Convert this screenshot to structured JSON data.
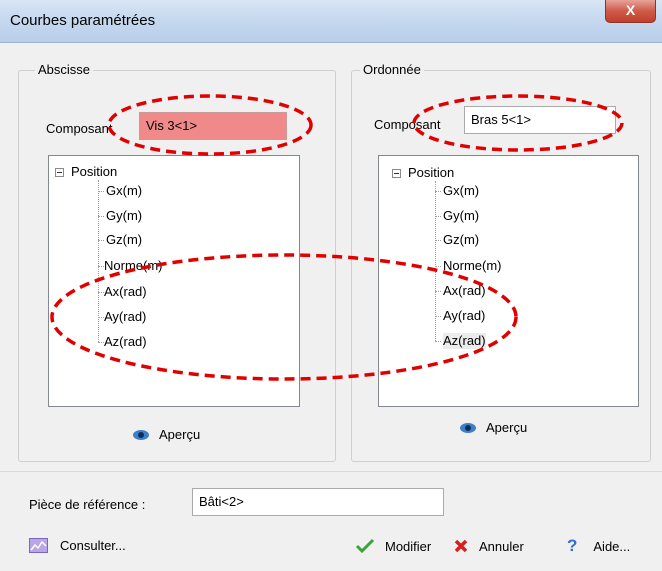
{
  "window": {
    "title": "Courbes paramétrées",
    "close_glyph": "X"
  },
  "abscisse": {
    "title": "Abscisse",
    "composant_label": "Composant",
    "composant_value": "Vis 3<1>",
    "tree_root": "Position",
    "tree_items": [
      "Gx(m)",
      "Gy(m)",
      "Gz(m)",
      "Norme(m)",
      "Ax(rad)",
      "Ay(rad)",
      "Az(rad)"
    ],
    "apercu": "Aperçu"
  },
  "ordonnee": {
    "title": "Ordonnée",
    "composant_label": "Composant",
    "composant_value": "Bras 5<1>",
    "tree_root": "Position",
    "tree_items": [
      "Gx(m)",
      "Gy(m)",
      "Gz(m)",
      "Norme(m)",
      "Ax(rad)",
      "Ay(rad)",
      "Az(rad)"
    ],
    "apercu": "Aperçu"
  },
  "reference": {
    "label": "Pièce de référence :",
    "value": "Bâti<2>"
  },
  "footer": {
    "consulter": "Consulter...",
    "modifier": "Modifier",
    "annuler": "Annuler",
    "aide": "Aide..."
  },
  "colors": {
    "highlight_field": "#f08a8a",
    "annotation": "#e00000",
    "modifier_check": "#3aa33a",
    "annuler_x": "#d62020",
    "aide_q": "#2f6fd1"
  },
  "icons": {
    "apercu": "eye-icon",
    "consulter": "chart-icon",
    "modifier": "checkmark-icon",
    "annuler": "cross-icon",
    "aide": "question-icon",
    "tree_toggle": "minus-box-icon"
  }
}
